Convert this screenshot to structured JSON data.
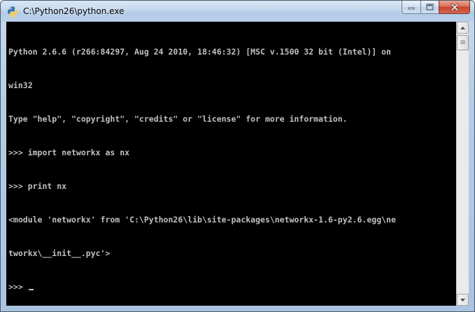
{
  "window": {
    "title": "C:\\Python26\\python.exe",
    "icon": "python-icon",
    "controls": {
      "minimize_icon": "minimize-icon",
      "maximize_icon": "maximize-icon",
      "close_icon": "close-icon"
    }
  },
  "console": {
    "lines": [
      "Python 2.6.6 (r266:84297, Aug 24 2010, 18:46:32) [MSC v.1500 32 bit (Intel)] on",
      "win32",
      "Type \"help\", \"copyright\", \"credits\" or \"license\" for more information.",
      ">>> import networkx as nx",
      ">>> print nx",
      "<module 'networkx' from 'C:\\Python26\\lib\\site-packages\\networkx-1.6-py2.6.egg\\ne",
      "tworkx\\__init__.pyc'>",
      ">>> "
    ],
    "text_color": "#c0c0c0",
    "background": "#000000"
  },
  "scrollbar": {
    "orientation": "vertical",
    "up_icon": "scroll-up-arrow-icon",
    "down_icon": "scroll-down-arrow-icon"
  },
  "colors": {
    "frame": "#b6cde6",
    "close_button": "#c8432a"
  }
}
